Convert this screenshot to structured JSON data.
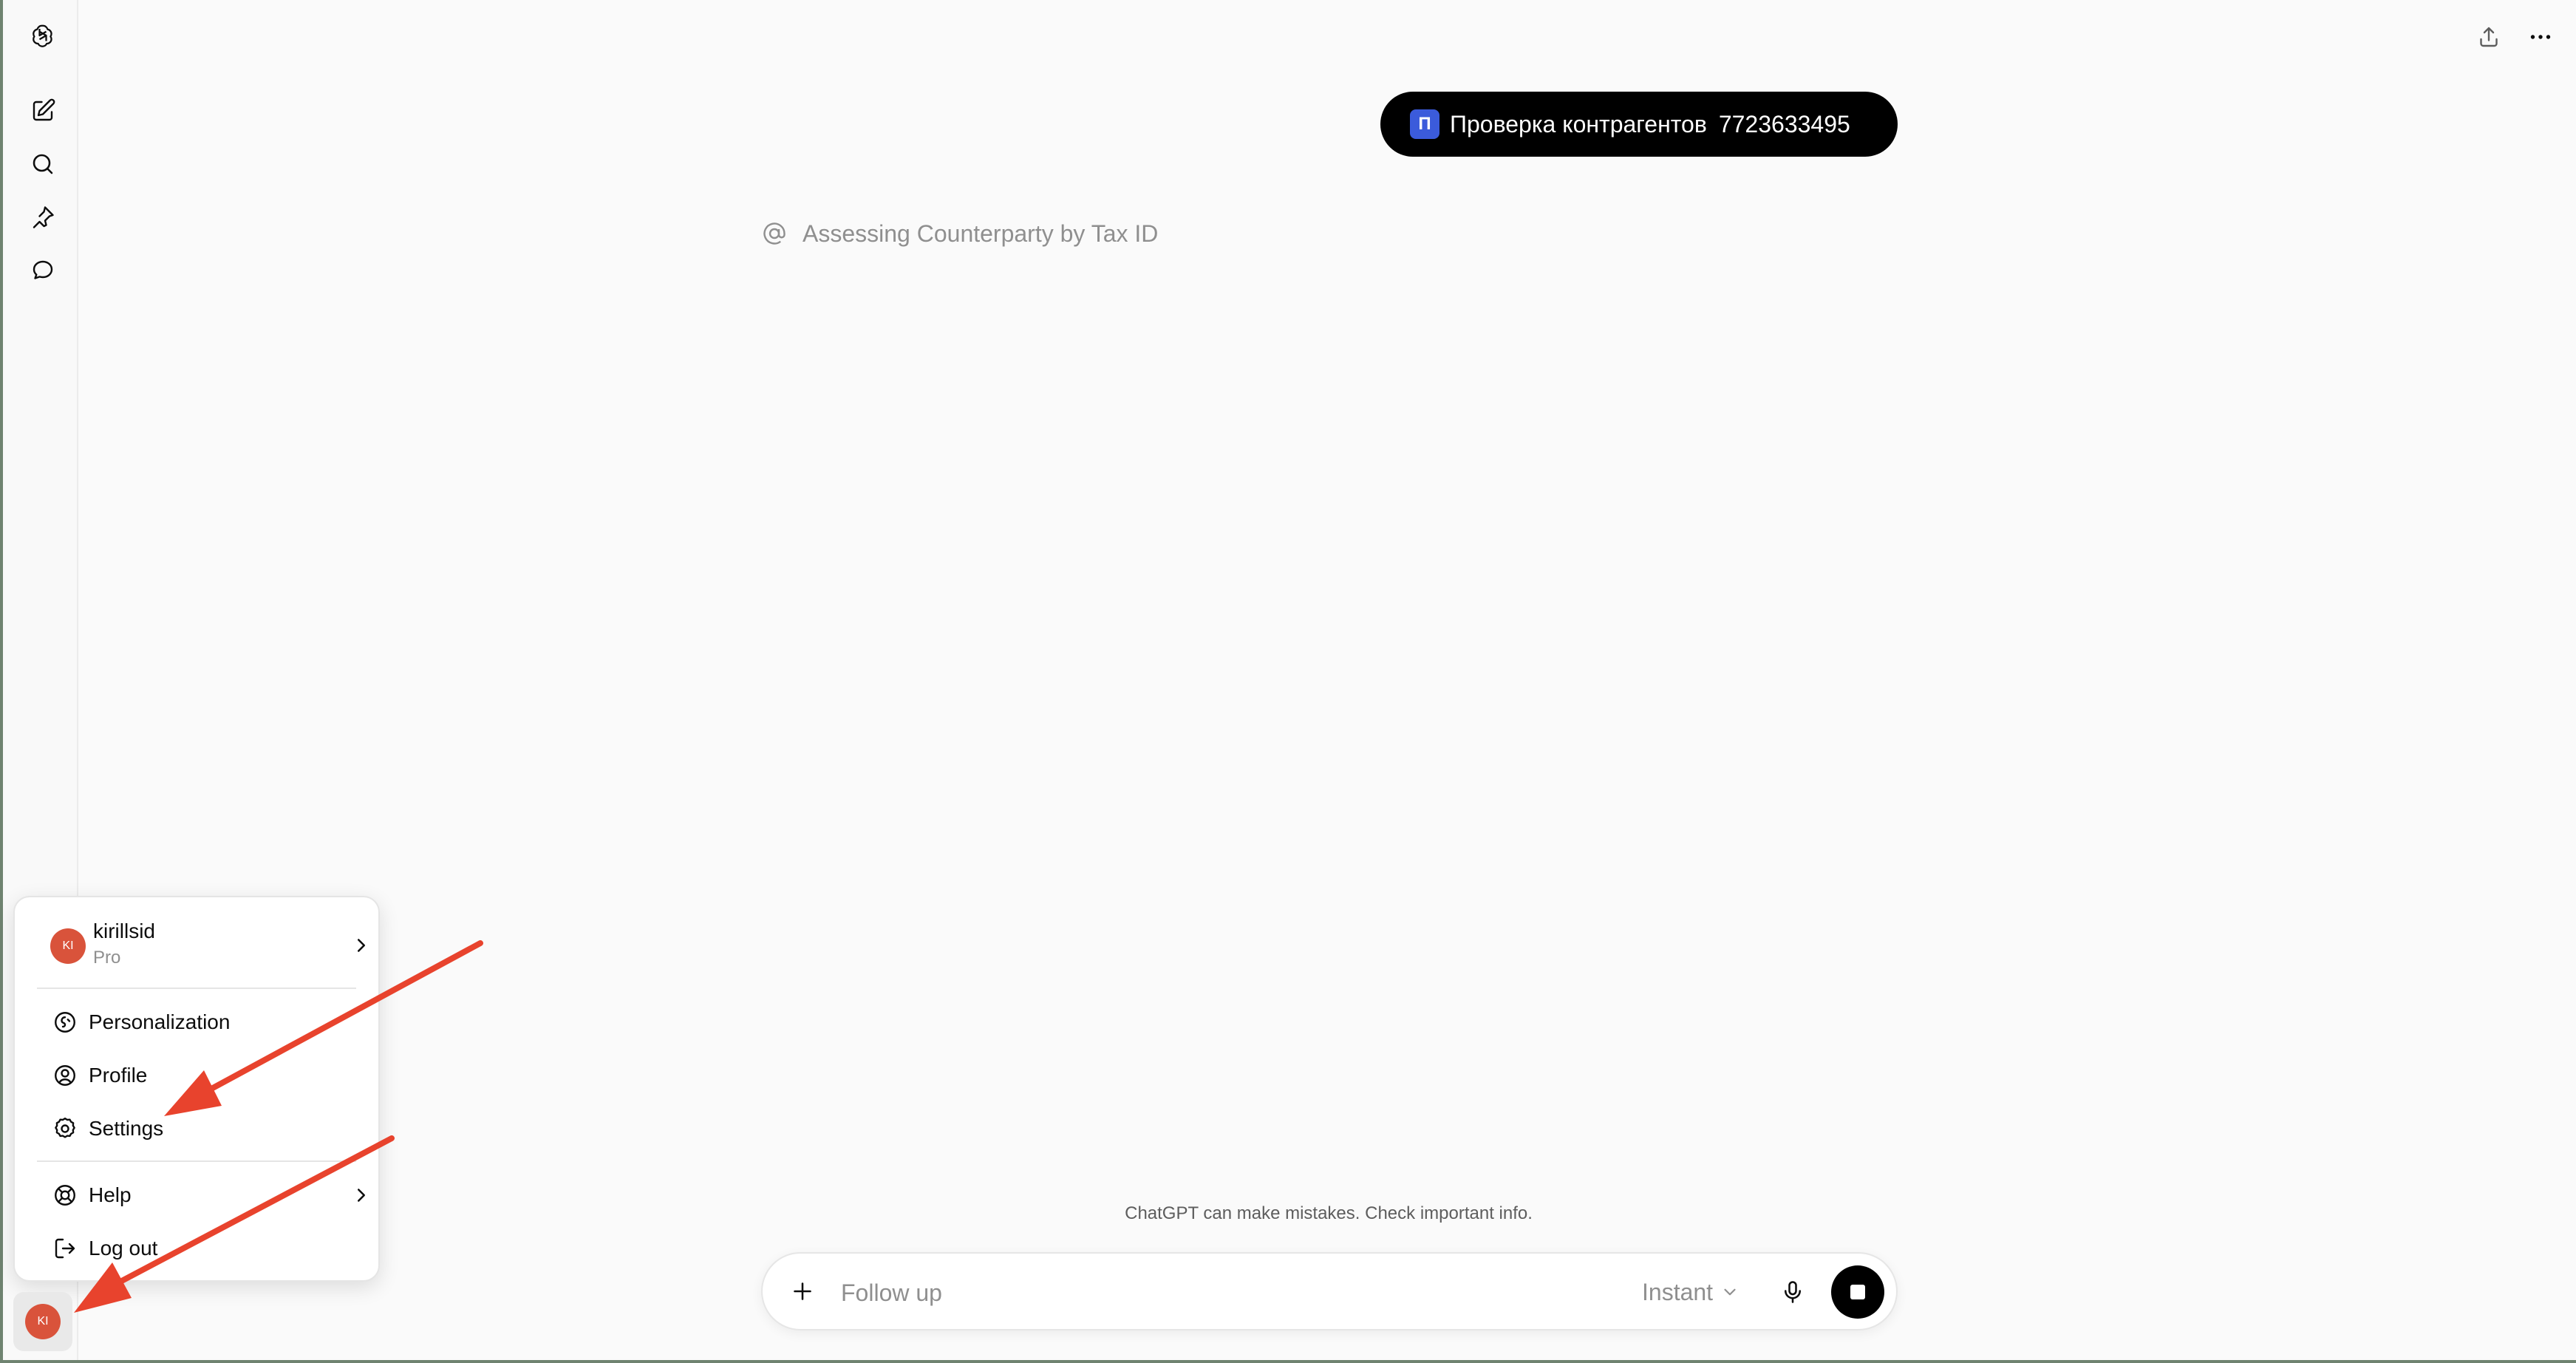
{
  "sidebar": {
    "items": [
      {
        "icon": "openai-logo-icon"
      },
      {
        "icon": "new-chat-icon"
      },
      {
        "icon": "search-icon"
      },
      {
        "icon": "pin-icon"
      },
      {
        "icon": "chat-bubble-icon"
      }
    ]
  },
  "header": {
    "actions": [
      {
        "icon": "share-icon"
      },
      {
        "icon": "more-horizontal-icon"
      }
    ]
  },
  "conversation": {
    "user_message": {
      "gpt_badge": "П",
      "gpt_name": "Проверка контрагентов",
      "text": "7723633495"
    },
    "assistant_status": "Assessing Counterparty by Tax ID"
  },
  "footer": {
    "disclaimer": "ChatGPT can make mistakes. Check important info."
  },
  "composer": {
    "placeholder": "Follow up",
    "model": "Instant"
  },
  "account_menu": {
    "avatar_initials": "KI",
    "username": "kirillsid",
    "plan": "Pro",
    "items": [
      {
        "label": "Personalization",
        "icon": "personalization-icon"
      },
      {
        "label": "Profile",
        "icon": "profile-icon"
      },
      {
        "label": "Settings",
        "icon": "gear-icon"
      },
      {
        "label": "Help",
        "icon": "help-lifebuoy-icon"
      },
      {
        "label": "Log out",
        "icon": "logout-icon"
      }
    ]
  },
  "colors": {
    "background": "#fafafa",
    "user_bubble": "#000000",
    "gpt_badge": "#3b5bdb",
    "avatar": "#d9533b",
    "annotation_arrow": "#e8432d"
  }
}
